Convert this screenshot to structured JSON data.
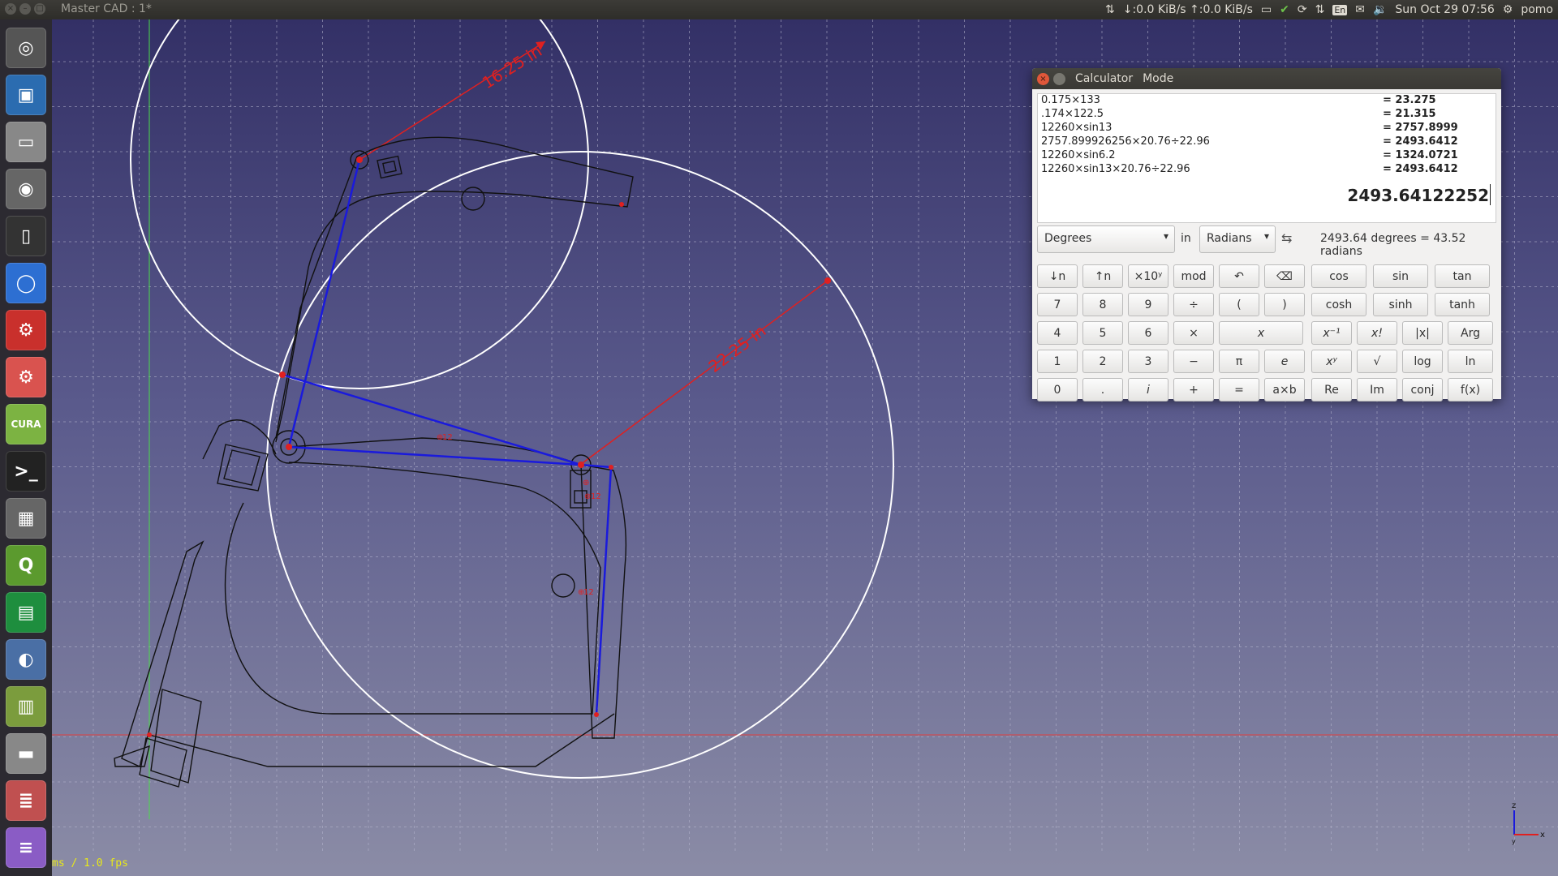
{
  "topbar": {
    "title": "Master CAD : 1*",
    "net_speed": "↓:0.0 KiB/s ↑:0.0 KiB/s",
    "keyboard": "En",
    "datetime": "Sun Oct 29 07:56",
    "user": "pomo"
  },
  "launcher": [
    {
      "name": "ubuntu-home-icon",
      "glyph": "◎",
      "color": "#555"
    },
    {
      "name": "image-viewer-icon",
      "glyph": "▣",
      "color": "#2b6cb0"
    },
    {
      "name": "drive-icon",
      "glyph": "▭",
      "color": "#888"
    },
    {
      "name": "camera-icon",
      "glyph": "◉",
      "color": "#666"
    },
    {
      "name": "phone-icon",
      "glyph": "▯",
      "color": "#333"
    },
    {
      "name": "chromium-icon",
      "glyph": "◯",
      "color": "#2d6fd2"
    },
    {
      "name": "freecad-icon",
      "glyph": "⚙",
      "color": "#c9302c"
    },
    {
      "name": "freecad-daily-icon",
      "glyph": "⚙",
      "color": "#d9534f"
    },
    {
      "name": "cura-icon",
      "glyph": "CURA",
      "color": "#7cb342"
    },
    {
      "name": "terminal-icon",
      "glyph": ">_",
      "color": "#222"
    },
    {
      "name": "calculator-icon",
      "glyph": "▦",
      "color": "#666"
    },
    {
      "name": "qgis-icon",
      "glyph": "Q",
      "color": "#5b9a2e"
    },
    {
      "name": "spreadsheet-icon",
      "glyph": "▤",
      "color": "#1e8e3e"
    },
    {
      "name": "media-icon",
      "glyph": "◐",
      "color": "#4a6fa5"
    },
    {
      "name": "chart-app-icon",
      "glyph": "▥",
      "color": "#7b9c3d"
    },
    {
      "name": "printer-icon",
      "glyph": "▬",
      "color": "#888"
    },
    {
      "name": "files-icon",
      "glyph": "≣",
      "color": "#c05050"
    },
    {
      "name": "stack-icon",
      "glyph": "≡",
      "color": "#8a5cc5"
    }
  ],
  "viewport": {
    "fps": "ms / 1.0 fps",
    "dim_small": "16.25 in",
    "dim_large": "22.25 in",
    "marker_12": "12"
  },
  "calculator": {
    "title": "Calculator",
    "menu": "Mode",
    "history": [
      {
        "expr": "0.175×133",
        "result": "= 23.275"
      },
      {
        "expr": ".174×122.5",
        "result": "= 21.315"
      },
      {
        "expr": "12260×sin13",
        "result": "= 2757.8999"
      },
      {
        "expr": "2757.899926256×20.76÷22.96",
        "result": "= 2493.6412"
      },
      {
        "expr": "12260×sin6.2",
        "result": "= 1324.0721"
      },
      {
        "expr": "12260×sin13×20.76÷22.96",
        "result": "= 2493.6412"
      }
    ],
    "display": "2493.64122252",
    "from_unit": "Degrees",
    "in_label": "in",
    "to_unit": "Radians",
    "swap": "⇆",
    "conversion": "2493.64 degrees = 43.52 radians",
    "buttons": [
      [
        "↓n",
        "↑n",
        "×10ʸ",
        "mod",
        "↶",
        "⌫",
        "cos",
        "sin",
        "tan"
      ],
      [
        "7",
        "8",
        "9",
        "÷",
        "(",
        ")",
        "cosh",
        "sinh",
        "tanh"
      ],
      [
        "4",
        "5",
        "6",
        "×",
        "x",
        "x⁻¹",
        "x!",
        "|x|",
        "Arg"
      ],
      [
        "1",
        "2",
        "3",
        "−",
        "π",
        "e",
        "xʸ",
        "√",
        "log",
        "ln"
      ],
      [
        "0",
        ".",
        "i",
        "+",
        "=",
        "a×b",
        "Re",
        "Im",
        "conj",
        "f(x)"
      ]
    ]
  }
}
